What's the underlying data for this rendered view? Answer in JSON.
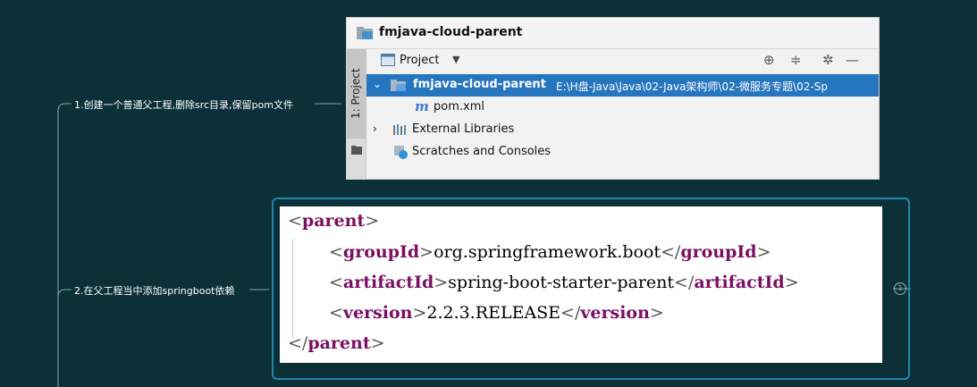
{
  "nodes": [
    {
      "label": "1.创建一个普通父工程,删除src目录,保留pom文件"
    },
    {
      "label": "2.在父工程当中添加springboot依赖"
    }
  ],
  "ide": {
    "window_title": "fmjava-cloud-parent",
    "side_tab": "1: Project",
    "toolbar": {
      "view_label": "Project"
    },
    "tree": {
      "root": "fmjava-cloud-parent",
      "root_path": "E:\\H盘-Java\\Java\\02-Java架构师\\02-微服务专题\\02-Sp",
      "file": "pom.xml",
      "file_icon": "m",
      "libraries": "External Libraries",
      "scratches": "Scratches and Consoles"
    }
  },
  "code": {
    "parent_tag": "parent",
    "group_tag": "groupId",
    "group_value": "org.springframework.boot",
    "artifact_tag": "artifactId",
    "artifact_value": "spring-boot-starter-parent",
    "version_tag": "version",
    "version_value": "2.2.3.RELEASE"
  },
  "collapse_count": "1",
  "colors": {
    "background": "#0b3038",
    "selection": "#2675bf",
    "xml_tag": "#7b0d63",
    "frame_border": "#1e88a8"
  }
}
